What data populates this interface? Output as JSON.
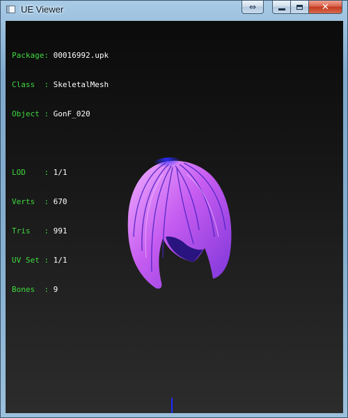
{
  "window": {
    "title": "UE Viewer",
    "buttons": {
      "resize": "⇔",
      "minimize": "",
      "maximize": "",
      "close": "✕"
    }
  },
  "info": {
    "package": {
      "label": "Package",
      "value": "00016992.upk"
    },
    "class": {
      "label": "Class  ",
      "value": "SkeletalMesh"
    },
    "object": {
      "label": "Object ",
      "value": "GonF_020"
    },
    "lod": {
      "label": "LOD    ",
      "value": "1/1"
    },
    "verts": {
      "label": "Verts  ",
      "value": "670"
    },
    "tris": {
      "label": "Tris   ",
      "value": "991"
    },
    "uvset": {
      "label": "UV Set ",
      "value": "1/1"
    },
    "bones": {
      "label": "Bones  ",
      "value": "9"
    },
    "separator": ": "
  },
  "colors": {
    "label": "#3fd93f",
    "value": "#ffffff",
    "hair_primary": "#c65cf0",
    "hair_highlight": "#f2b4ff",
    "hair_shadow": "#3a1fd0"
  },
  "icons": [
    "app-window-icon",
    "resize-icon",
    "minimize-icon",
    "maximize-icon",
    "close-icon"
  ]
}
